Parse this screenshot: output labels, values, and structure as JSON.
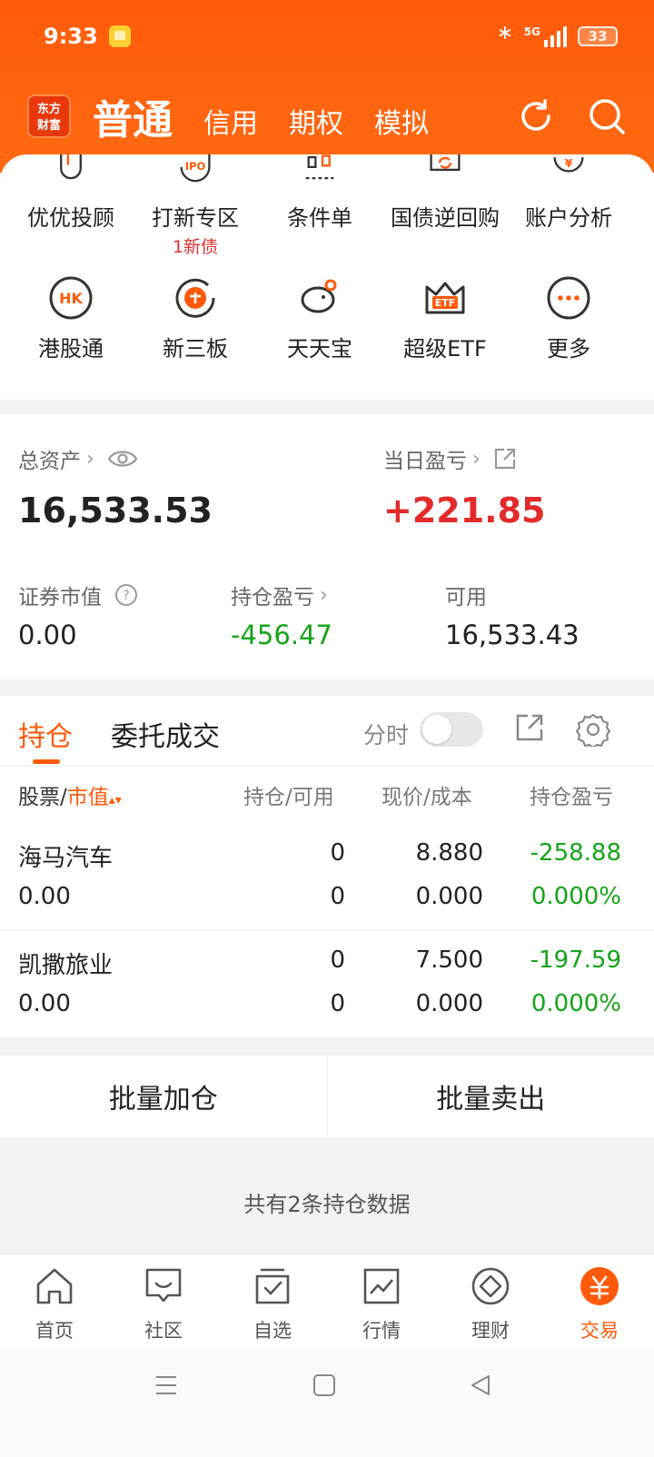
{
  "status": {
    "time": "9:33",
    "network": "5G",
    "battery": "33"
  },
  "nav": {
    "logo": "东方财富",
    "tabs": [
      {
        "label": "普通"
      },
      {
        "label": "信用"
      },
      {
        "label": "期权"
      },
      {
        "label": "模拟"
      }
    ],
    "refresh_icon": "refresh-icon",
    "search_icon": "search-icon"
  },
  "quick_menu": [
    {
      "label": "优优投顾",
      "icon": "uu-advisor-icon"
    },
    {
      "label": "打新专区",
      "icon": "ipo-icon",
      "sub": "1新债"
    },
    {
      "label": "条件单",
      "icon": "condition-order-icon"
    },
    {
      "label": "国债逆回购",
      "icon": "repo-icon"
    },
    {
      "label": "账户分析",
      "icon": "account-analysis-icon"
    },
    {
      "label": "港股通",
      "icon": "hk-icon"
    },
    {
      "label": "新三板",
      "icon": "neeq-icon"
    },
    {
      "label": "天天宝",
      "icon": "piggy-bank-icon"
    },
    {
      "label": "超级ETF",
      "icon": "etf-crown-icon"
    },
    {
      "label": "更多",
      "icon": "more-icon"
    }
  ],
  "assets": {
    "total_label": "总资产",
    "total_value": "16,533.53",
    "daily_pl_label": "当日盈亏",
    "daily_pl_value": "+221.85",
    "market_value_label": "证券市值",
    "market_value": "0.00",
    "position_pl_label": "持仓盈亏",
    "position_pl_value": "-456.47",
    "available_label": "可用",
    "available_value": "16,533.43"
  },
  "positions": {
    "tab_active": "持仓",
    "tab_inactive": "委托成交",
    "toggle_label": "分时",
    "toggle_on": false,
    "headers": {
      "stock": "股票",
      "sep": "/",
      "market_value": "市值",
      "hold_avail": "持仓/可用",
      "price_cost": "现价/成本",
      "pl": "持仓盈亏"
    },
    "rows": [
      {
        "name": "海马汽车",
        "value": "0.00",
        "hold": "0",
        "avail": "0",
        "price": "8.880",
        "cost": "0.000",
        "pl": "-258.88",
        "pl_pct": "0.000%"
      },
      {
        "name": "凯撒旅业",
        "value": "0.00",
        "hold": "0",
        "avail": "0",
        "price": "7.500",
        "cost": "0.000",
        "pl": "-197.59",
        "pl_pct": "0.000%"
      }
    ]
  },
  "batch": {
    "add": "批量加仓",
    "sell": "批量卖出"
  },
  "summary": "共有2条持仓数据",
  "bottom_nav": [
    {
      "label": "首页",
      "icon": "home-icon"
    },
    {
      "label": "社区",
      "icon": "community-icon"
    },
    {
      "label": "自选",
      "icon": "watchlist-icon"
    },
    {
      "label": "行情",
      "icon": "market-icon"
    },
    {
      "label": "理财",
      "icon": "wealth-icon"
    },
    {
      "label": "交易",
      "icon": "trade-icon",
      "active": true
    }
  ],
  "colors": {
    "brand": "#ff5a0a",
    "gain": "#e22a2a",
    "loss": "#16a31a"
  }
}
